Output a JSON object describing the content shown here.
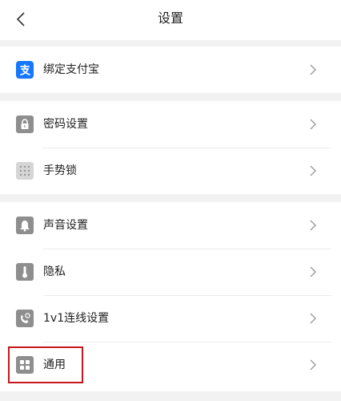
{
  "header": {
    "title": "设置"
  },
  "sections": [
    {
      "items": [
        {
          "label": "绑定支付宝",
          "icon": "alipay-icon"
        }
      ]
    },
    {
      "items": [
        {
          "label": "密码设置",
          "icon": "lock-icon"
        },
        {
          "label": "手势锁",
          "icon": "gesture-grid-icon"
        }
      ]
    },
    {
      "items": [
        {
          "label": "声音设置",
          "icon": "bell-icon"
        },
        {
          "label": "隐私",
          "icon": "thermometer-icon"
        },
        {
          "label": "1v1连线设置",
          "icon": "phone-link-icon"
        },
        {
          "label": "通用",
          "icon": "grid-apps-icon"
        }
      ]
    }
  ],
  "colors": {
    "alipay_blue": "#1677ff",
    "icon_gray": "#8e8e8e",
    "highlight_red": "#c8161d",
    "background": "#f2f2f2"
  }
}
